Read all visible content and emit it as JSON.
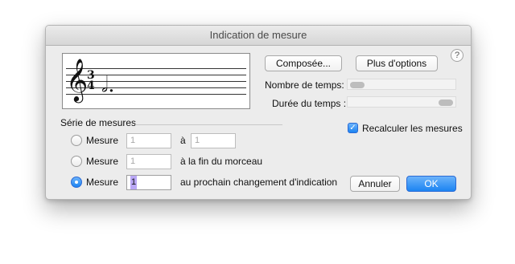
{
  "window": {
    "title": "Indication de mesure"
  },
  "top_buttons": {
    "composee": "Composée...",
    "plus_options": "Plus d'options",
    "help": "?"
  },
  "time_signature": {
    "numerator": "3",
    "denominator": "4",
    "clef_glyph": "𝄞",
    "note_glyph": "𝅗𝅥."
  },
  "beats": {
    "label": "Nombre de temps:",
    "level": 0.0
  },
  "beat_duration": {
    "label": "Durée du temps :",
    "level": 1.0
  },
  "measures_group": {
    "title": "Série de mesures",
    "rows": [
      {
        "label": "Mesure",
        "field": "1",
        "selected": false,
        "middle_text": "à",
        "end_field": "1"
      },
      {
        "label": "Mesure",
        "field": "1",
        "selected": false,
        "middle_text": "à la fin du morceau"
      },
      {
        "label": "Mesure",
        "field": "1",
        "selected": true,
        "middle_text": "au prochain changement d'indication"
      }
    ]
  },
  "recalc": {
    "label": "Recalculer les mesures",
    "checked": true
  },
  "footer": {
    "cancel": "Annuler",
    "ok": "OK"
  },
  "colors": {
    "accent": "#1c84f2",
    "selection": "#b9a7f5"
  },
  "icons": {
    "check": "checkmark-icon"
  }
}
